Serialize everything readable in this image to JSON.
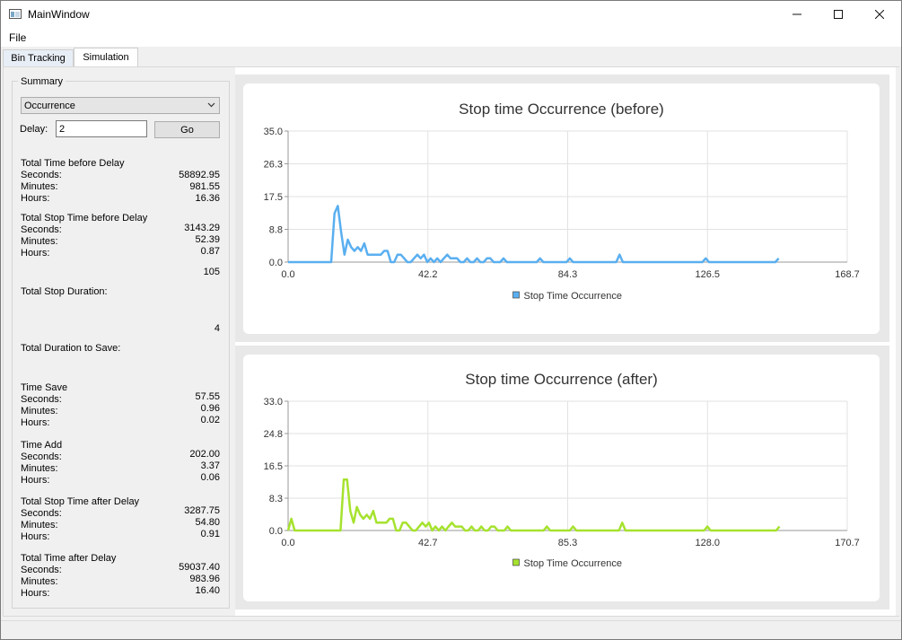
{
  "window": {
    "title": "MainWindow",
    "minimize": "—",
    "maximize": "☐",
    "close": "✕"
  },
  "menu": {
    "file": "File"
  },
  "tabs": [
    {
      "label": "Bin Tracking"
    },
    {
      "label": "Simulation"
    }
  ],
  "summary": {
    "group_title": "Summary",
    "combo_value": "Occurrence",
    "delay_label": "Delay:",
    "delay_value": "2",
    "go_label": "Go",
    "sections": {
      "ttb": {
        "title": "Total Time before Delay",
        "seconds_label": "Seconds:",
        "seconds": "58892.95",
        "minutes_label": "Minutes:",
        "minutes": "981.55",
        "hours_label": "Hours:",
        "hours": "16.36"
      },
      "tstb": {
        "title": "Total Stop Time before Delay",
        "seconds_label": "Seconds:",
        "seconds": "3143.29",
        "minutes_label": "Minutes:",
        "minutes": "52.39",
        "hours_label": "Hours:",
        "hours": "0.87"
      },
      "tsd": {
        "value": "105",
        "title": "Total Stop Duration:"
      },
      "tds": {
        "value": "4",
        "title": "Total Duration to Save:"
      },
      "ts": {
        "title": "Time Save",
        "seconds_label": "Seconds:",
        "seconds": "57.55",
        "minutes_label": "Minutes:",
        "minutes": "0.96",
        "hours_label": "Hours:",
        "hours": "0.02"
      },
      "ta": {
        "title": "Time Add",
        "seconds_label": "Seconds:",
        "seconds": "202.00",
        "minutes_label": "Minutes:",
        "minutes": "3.37",
        "hours_label": "Hours:",
        "hours": "0.06"
      },
      "tsta": {
        "title": "Total Stop Time after Delay",
        "seconds_label": "Seconds:",
        "seconds": "3287.75",
        "minutes_label": "Minutes:",
        "minutes": "54.80",
        "hours_label": "Hours:",
        "hours": "0.91"
      },
      "tta": {
        "title": "Total Time after Delay",
        "seconds_label": "Seconds:",
        "seconds": "59037.40",
        "minutes_label": "Minutes:",
        "minutes": "983.96",
        "hours_label": "Hours:",
        "hours": "16.40"
      }
    }
  },
  "chart_data": [
    {
      "type": "line",
      "title": "Stop time Occurrence (before)",
      "color": "#5aaff0",
      "xlim": [
        0.0,
        168.7
      ],
      "ylim": [
        0.0,
        35.0
      ],
      "x_ticks": [
        "0.0",
        "42.2",
        "84.3",
        "126.5",
        "168.7"
      ],
      "y_ticks": [
        "0.0",
        "8.8",
        "17.5",
        "26.3",
        "35.0"
      ],
      "grid": true,
      "legend_position": "bottom",
      "series": [
        {
          "name": "Stop Time Occurrence",
          "x": [
            0,
            13,
            14,
            15,
            16,
            17,
            18,
            19,
            20,
            21,
            22,
            23,
            24,
            26,
            28,
            29,
            30,
            31,
            32,
            33,
            34,
            35,
            36,
            37,
            38,
            39,
            40,
            41,
            42,
            43,
            44,
            45,
            46,
            47,
            48,
            49,
            50,
            51,
            52,
            53,
            54,
            55,
            56,
            57,
            58,
            59,
            60,
            61,
            62,
            63,
            64,
            65,
            66,
            67,
            68,
            69,
            70,
            71,
            75,
            76,
            77,
            78,
            84,
            85,
            86,
            99,
            100,
            101,
            125,
            126,
            127,
            147,
            148
          ],
          "y": [
            0,
            0,
            13,
            15,
            8,
            2,
            6,
            4,
            3,
            4,
            3,
            5,
            2,
            2,
            2,
            3,
            3,
            0,
            0,
            2,
            2,
            1,
            0,
            0,
            1,
            2,
            1,
            2,
            0,
            1,
            0,
            1,
            0,
            1,
            2,
            1,
            1,
            1,
            0,
            0,
            1,
            0,
            0,
            1,
            0,
            0,
            1,
            1,
            0,
            0,
            0,
            1,
            0,
            0,
            0,
            0,
            0,
            0,
            0,
            1,
            0,
            0,
            0,
            1,
            0,
            0,
            2,
            0,
            0,
            1,
            0,
            0,
            1
          ]
        }
      ]
    },
    {
      "type": "line",
      "title": "Stop time Occurrence (after)",
      "color": "#a6e22e",
      "xlim": [
        0.0,
        170.7
      ],
      "ylim": [
        0.0,
        33.0
      ],
      "x_ticks": [
        "0.0",
        "42.7",
        "85.3",
        "128.0",
        "170.7"
      ],
      "y_ticks": [
        "0.0",
        "8.3",
        "16.5",
        "24.8",
        "33.0"
      ],
      "grid": true,
      "legend_position": "bottom",
      "series": [
        {
          "name": "Stop Time Occurrence",
          "x": [
            0,
            1,
            2,
            16,
            17,
            18,
            19,
            20,
            21,
            22,
            23,
            24,
            25,
            26,
            27,
            29,
            30,
            31,
            32,
            33,
            34,
            35,
            36,
            37,
            38,
            39,
            40,
            41,
            42,
            43,
            44,
            45,
            46,
            47,
            48,
            49,
            50,
            51,
            52,
            53,
            54,
            55,
            56,
            57,
            58,
            59,
            60,
            61,
            62,
            63,
            64,
            65,
            66,
            67,
            68,
            69,
            70,
            71,
            72,
            73,
            74,
            75,
            76,
            77,
            78,
            79,
            80,
            86,
            87,
            88,
            101,
            102,
            103,
            127,
            128,
            129,
            149,
            150
          ],
          "y": [
            0,
            3,
            0,
            0,
            13,
            13,
            5,
            2,
            6,
            4,
            3,
            4,
            3,
            5,
            2,
            2,
            2,
            3,
            3,
            0,
            0,
            2,
            2,
            1,
            0,
            0,
            1,
            2,
            1,
            2,
            0,
            1,
            0,
            1,
            0,
            1,
            2,
            1,
            1,
            1,
            0,
            0,
            1,
            0,
            0,
            1,
            0,
            0,
            1,
            1,
            0,
            0,
            0,
            1,
            0,
            0,
            0,
            0,
            0,
            0,
            0,
            0,
            0,
            0,
            0,
            1,
            0,
            0,
            1,
            0,
            0,
            2,
            0,
            0,
            1,
            0,
            0,
            1
          ]
        }
      ]
    }
  ]
}
